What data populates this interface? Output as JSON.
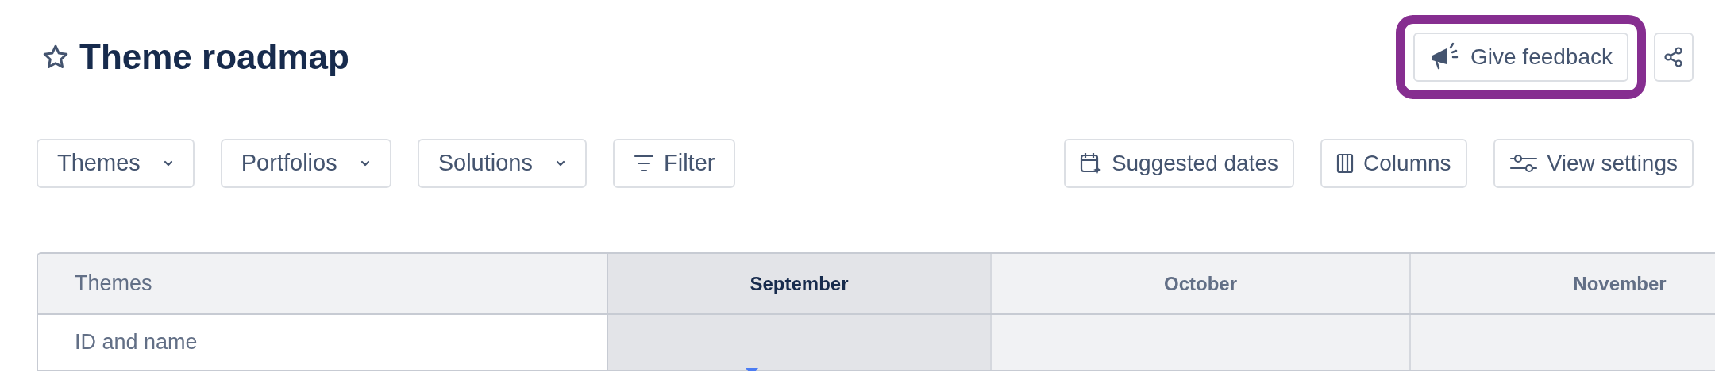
{
  "header": {
    "title": "Theme roadmap",
    "starred": false,
    "feedback_button": {
      "label": "Give feedback",
      "highlighted": true
    }
  },
  "filters": [
    {
      "label": "Themes",
      "kind": "dropdown"
    },
    {
      "label": "Portfolios",
      "kind": "dropdown"
    },
    {
      "label": "Solutions",
      "kind": "dropdown"
    },
    {
      "label": "Filter",
      "kind": "filter"
    }
  ],
  "actions": [
    {
      "label": "Suggested dates",
      "kind": "calendar"
    },
    {
      "label": "Columns",
      "kind": "columns"
    },
    {
      "label": "View settings",
      "kind": "sliders"
    }
  ],
  "table": {
    "columns": [
      {
        "label": "Themes"
      }
    ],
    "months": [
      {
        "label": "September",
        "selected": true
      },
      {
        "label": "October",
        "selected": false
      },
      {
        "label": "November",
        "selected": false
      }
    ],
    "rows": [
      {
        "label": "ID and name"
      }
    ]
  }
}
